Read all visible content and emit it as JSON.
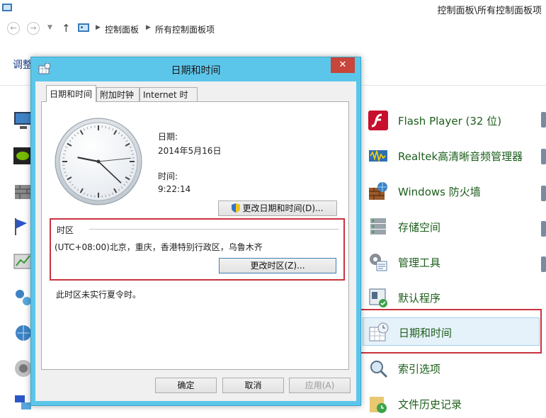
{
  "window": {
    "breadcrumb_path": "控制面板\\所有控制面板项",
    "nav": {
      "back_icon": "back-arrow-icon",
      "forward_icon": "forward-arrow-icon",
      "crumb1": "控制面板",
      "crumb2": "所有控制面板项"
    },
    "heading": "调整"
  },
  "right_items": [
    {
      "label": "Flash Player (32 位)",
      "icon": "flash-icon"
    },
    {
      "label": "Realtek高清晰音频管理器",
      "icon": "audio-manager-icon"
    },
    {
      "label": "Windows 防火墙",
      "icon": "firewall-icon"
    },
    {
      "label": "存储空间",
      "icon": "storage-icon"
    },
    {
      "label": "管理工具",
      "icon": "admin-tools-icon"
    },
    {
      "label": "默认程序",
      "icon": "default-programs-icon"
    },
    {
      "label": "日期和时间",
      "icon": "calendar-clock-icon"
    },
    {
      "label": "索引选项",
      "icon": "search-index-icon"
    },
    {
      "label": "文件历史记录",
      "icon": "file-history-icon"
    }
  ],
  "dialog": {
    "title": "日期和时间",
    "close_glyph": "✕",
    "tabs": [
      "日期和时间",
      "附加时钟",
      "Internet 时间"
    ],
    "date_label": "日期:",
    "date_value": "2014年5月16日",
    "time_label": "时间:",
    "time_value": "9:22:14",
    "change_datetime_button": "更改日期和时间(D)...",
    "timezone_title": "时区",
    "timezone_value": "(UTC+08:00)北京，重庆，香港特别行政区，乌鲁木齐",
    "change_timezone_button": "更改时区(Z)...",
    "dst_note": "此时区未实行夏令时。",
    "ok_button": "确定",
    "cancel_button": "取消",
    "apply_button": "应用(A)"
  },
  "clock": {
    "hours": 9,
    "minutes": 22,
    "seconds": 14
  },
  "colors": {
    "dialog_frame": "#5cc6ea",
    "highlight": "#c8323e",
    "link_green": "#1c5e1c"
  }
}
